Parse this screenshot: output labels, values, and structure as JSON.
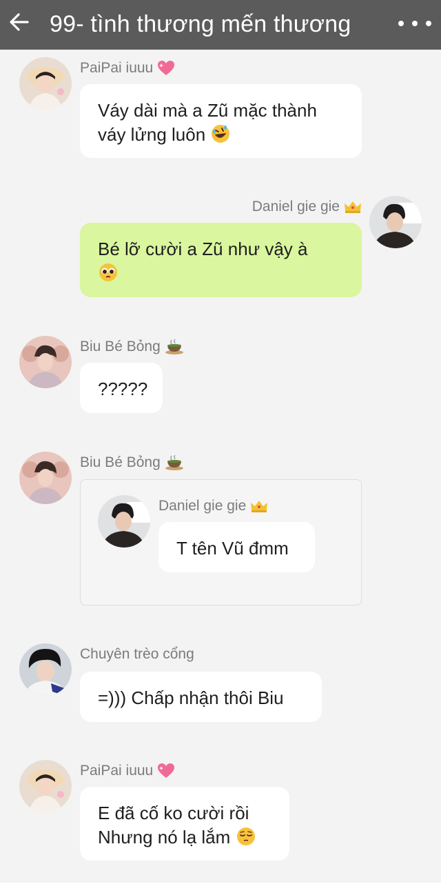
{
  "header": {
    "title": "99- tình thương mến thương"
  },
  "messages": [
    {
      "sender": "PaiPai iuuu",
      "sender_badge_icon": "sparkling-heart-icon",
      "lines": [
        "Váy dài mà a Zũ mặc thành",
        "váy lửng luôn"
      ],
      "trailing_emoji": "rolling-laughing-emoji"
    },
    {
      "sender": "Daniel gie gie",
      "sender_badge_icon": "crown-icon",
      "lines": [
        "Bé lỡ cười a Zũ như vậy à",
        ""
      ],
      "trailing_emoji": "pleading-face-emoji"
    },
    {
      "sender": "Biu Bé Bỏng",
      "sender_badge_icon": "hot-tea-icon",
      "lines": [
        "?????"
      ]
    },
    {
      "sender": "Biu Bé Bỏng",
      "sender_badge_icon": "hot-tea-icon",
      "quoted": {
        "sender": "Daniel gie gie",
        "sender_badge_icon": "crown-icon",
        "text": "T tên Vũ đmm"
      }
    },
    {
      "sender": "Chuyên trèo cổng",
      "lines": [
        "=))) Chấp nhận thôi Biu"
      ]
    },
    {
      "sender": "PaiPai iuuu",
      "sender_badge_icon": "sparkling-heart-icon",
      "lines": [
        "E đã cố ko cười rồi",
        "Nhưng nó lạ lắm"
      ],
      "trailing_emoji": "pensive-face-emoji"
    }
  ],
  "colors": {
    "header_bg": "#5b5b5b",
    "chat_bg": "#f3f3f3",
    "incoming_bubble": "#ffffff",
    "outgoing_bubble": "#daf69e",
    "sender_name": "#7b7b7b"
  }
}
